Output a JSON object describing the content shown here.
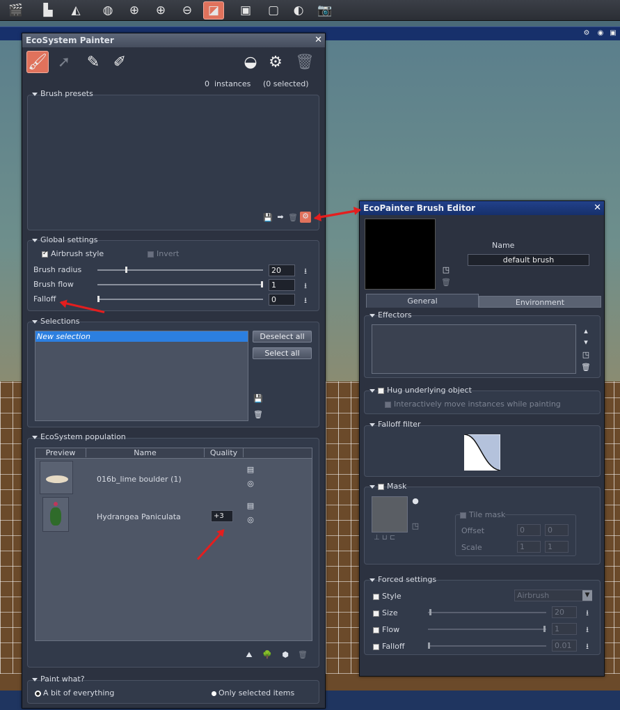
{
  "ecosystem_painter": {
    "title": "EcoSystem Painter",
    "instances_count": "0",
    "instances_label": "instances",
    "selected_label": "(0 selected)",
    "brush_presets": {
      "title": "Brush presets"
    },
    "global_settings": {
      "title": "Global settings",
      "airbrush_label": "Airbrush style",
      "invert_label": "Invert",
      "brush_radius_label": "Brush radius",
      "brush_radius_value": "20",
      "brush_flow_label": "Brush flow",
      "brush_flow_value": "1",
      "falloff_label": "Falloff",
      "falloff_value": "0"
    },
    "selections": {
      "title": "Selections",
      "items": [
        "New selection"
      ],
      "deselect_all": "Deselect all",
      "select_all": "Select all"
    },
    "population": {
      "title": "EcoSystem population",
      "columns": [
        "Preview",
        "Name",
        "Quality"
      ],
      "rows": [
        {
          "name": "016b_lime boulder (1)",
          "quality": ""
        },
        {
          "name": "Hydrangea Paniculata",
          "quality": "+3"
        }
      ]
    },
    "paint_what": {
      "title": "Paint what?",
      "option_everything": "A bit of everything",
      "option_selected": "Only selected items"
    }
  },
  "brush_editor": {
    "title": "EcoPainter Brush Editor",
    "name_label": "Name",
    "name_value": "default brush",
    "tabs": [
      "General",
      "Environment"
    ],
    "effectors": {
      "title": "Effectors"
    },
    "hug_label": "Hug underlying object",
    "interactive_label": "Interactively move instances while painting",
    "falloff_filter": {
      "title": "Falloff filter"
    },
    "mask": {
      "title": "Mask",
      "tile_mask": "Tile mask",
      "offset_label": "Offset",
      "offset_x": "0",
      "offset_y": "0",
      "scale_label": "Scale",
      "scale_x": "1",
      "scale_y": "1"
    },
    "forced": {
      "title": "Forced settings",
      "style_label": "Style",
      "style_value": "Airbrush",
      "size_label": "Size",
      "size_value": "20",
      "flow_label": "Flow",
      "flow_value": "1",
      "falloff_label": "Falloff",
      "falloff_value": "0.01"
    }
  }
}
